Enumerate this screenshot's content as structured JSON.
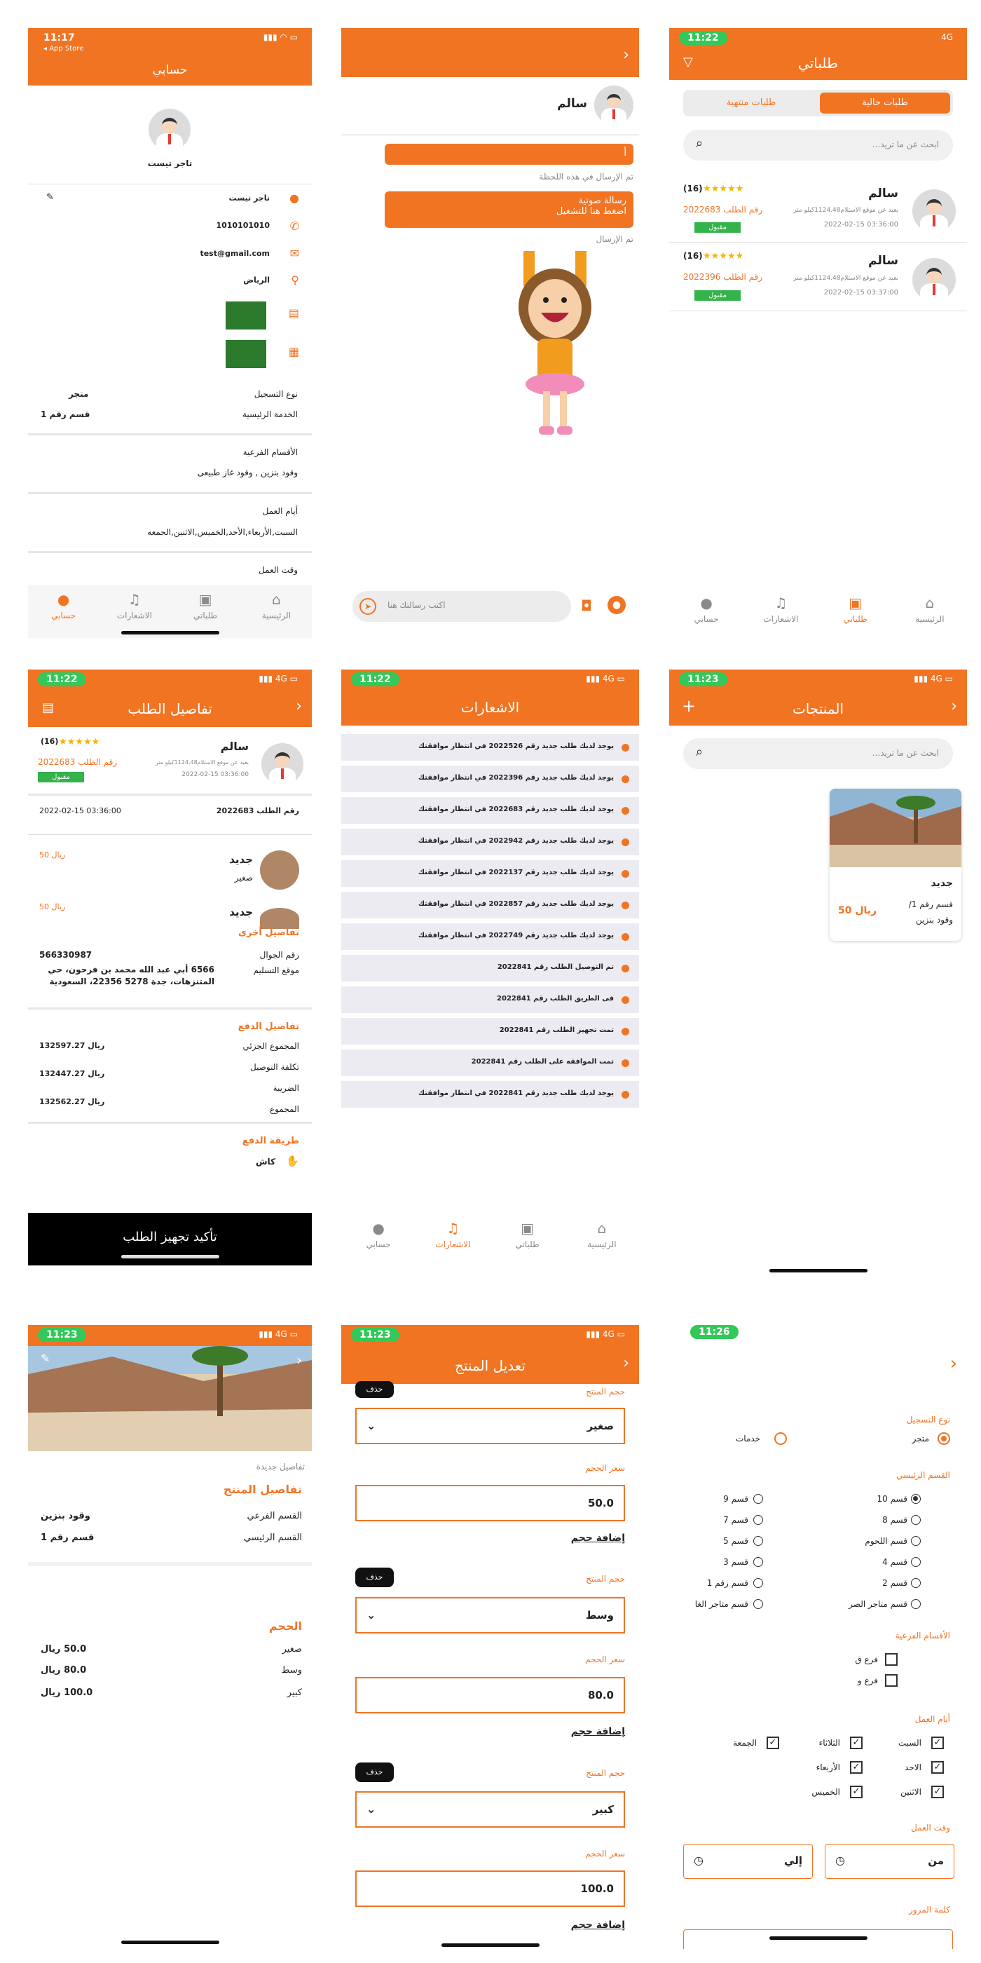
{
  "s1": {
    "time": "11:17",
    "back_store": "◂ App Store",
    "title": "حسابي",
    "name": "تاجر تيست",
    "rows": [
      {
        "icon": "person-icon",
        "value": "تاجر تيست"
      },
      {
        "icon": "phone-icon",
        "value": "1010101010"
      },
      {
        "icon": "mail-icon",
        "value": "test@gmail.com"
      },
      {
        "icon": "location-icon",
        "value": "الرياض"
      }
    ],
    "reg_type_label": "نوع التسجيل",
    "reg_type_value": "متجر",
    "main_label": "الخدمة الرئيسية",
    "main_value": "قسم رقم 1",
    "sub_label": "الأقسام الفرعية",
    "sub_value": "وقود بنزين , وقود غاز طبيعى",
    "days_label": "أيام العمل",
    "days_value": "السبت,الأربعاء,الأحد,الخميس,الاثنين,الجمعه",
    "time_label": "وقت العمل"
  },
  "nav": {
    "home": "الرئيسية",
    "orders": "طلباتي",
    "notifs": "الاشعارات",
    "account": "حسابي"
  },
  "s2": {
    "name": "سالم",
    "msg1": "أ",
    "msg1_status": "تم الإرسال في هذه اللحظة",
    "msg2_line1": "رسالة صوتية",
    "msg2_line2": "اضغط هنا للتشغيل",
    "msg2_status": "تم الإرسال",
    "input_placeholder": "اكتب رسالتك هنا"
  },
  "s3": {
    "time": "11:22",
    "sig": "4G",
    "title": "طلباتي",
    "tab_current": "طلبات حالية",
    "tab_done": "طلبات منتهية",
    "search_placeholder": "ابحث عن ما تريد...",
    "orders": [
      {
        "name": "سالم",
        "count": "(16)",
        "loc": "بعيد عن موقع الاستلام1124.48كيلو متر",
        "order": "رقم الطلب 2022683",
        "date": "2022-02-15 03:36:00",
        "status": "مقبول"
      },
      {
        "name": "سالم",
        "count": "(16)",
        "loc": "بعيد عن موقع الاستلام1124.48كيلو متر",
        "order": "رقم الطلب 2022396",
        "date": "2022-02-15 03:37:00",
        "status": "مقبول"
      }
    ]
  },
  "s4": {
    "time": "11:22",
    "title": "تفاصيل الطلب",
    "name": "سالم",
    "count": "(16)",
    "order": "رقم الطلب 2022683",
    "loc": "بعيد عن موقع الاستلام1124.48كيلو متر",
    "date": "2022-02-15 03:36:00",
    "status": "مقبول",
    "order_no": "رقم الطلب 2022683",
    "date2": "2022-02-15 03:36:00",
    "items": [
      {
        "name": "جديد",
        "size": "صغير",
        "price": "50 ريال"
      },
      {
        "name": "جديد",
        "size": "",
        "price": "50 ريال"
      }
    ],
    "other_title": "تفاصيل أخرى",
    "phone_label": "رقم الجوال",
    "phone": "566330987",
    "addr_label": "موقع التسليم",
    "addr": "6566 أبي عبد الله محمد بن فرحون، حي المتنزهات، جدة 5278 22356، السعودية",
    "pay_title": "تفاصيل الدفع",
    "subtotal_label": "المجموع الجزئي",
    "subtotal": "132597.27 ريال",
    "delivery_label": "تكلفة التوصيل",
    "delivery": "132447.27 ريال",
    "tax_label": "الضريبة",
    "total_label": "المجموع",
    "total": "132562.27 ريال",
    "method_title": "طريقة الدفع",
    "method": "كاش",
    "confirm": "تأكيد تجهيز الطلب"
  },
  "s5": {
    "time": "11:22",
    "title": "الاشعارات",
    "items": [
      "يوجد لديك طلب جديد رقم 2022526 في انتظار موافقتك",
      "يوجد لديك طلب جديد رقم 2022396 في انتظار موافقتك",
      "يوجد لديك طلب جديد رقم 2022683 في انتظار موافقتك",
      "يوجد لديك طلب جديد رقم 2022942 في انتظار موافقتك",
      "يوجد لديك طلب جديد رقم 2022137 في انتظار موافقتك",
      "يوجد لديك طلب جديد رقم 2022857 في انتظار موافقتك",
      "يوجد لديك طلب جديد رقم 2022749 في انتظار موافقتك",
      "تم التوصيل الطلب رقم 2022841",
      "فى الطريق الطلب رقم 2022841",
      "تمت تجهيز الطلب رقم 2022841",
      "تمت الموافقه على الطلب رقم 2022841",
      "يوجد لديك طلب جديد رقم 2022841 في انتظار موافقتك"
    ]
  },
  "s6": {
    "time": "11:23",
    "title": "المنتجات",
    "search_placeholder": "ابحث عن ما تريد...",
    "product_name": "جديد",
    "product_cat": "قسم رقم 1/",
    "product_sub": "وقود بنزين",
    "product_price": "50 ريال"
  },
  "s7": {
    "time": "11:23",
    "more": "تفاصيل جديدة",
    "title": "تفاصيل المنتج",
    "sub_label": "القسم الفرعي",
    "sub_value": "وقود بنزين",
    "main_label": "القسم الرئيسي",
    "main_value": "قسم رقم 1",
    "size_title": "الحجم",
    "sizes": [
      {
        "name": "صغير",
        "price": "50.0 ريال"
      },
      {
        "name": "وسط",
        "price": "80.0 ريال"
      },
      {
        "name": "كبير",
        "price": "100.0 ريال"
      }
    ]
  },
  "s8": {
    "time": "11:23",
    "title": "تعديل المنتج",
    "size_label": "حجم المنتج",
    "price_label": "سعر الحجم",
    "delete": "حذف",
    "add": "إضافة حجم",
    "sizes": [
      {
        "name": "صغير",
        "price": "50.0"
      },
      {
        "name": "وسط",
        "price": "80.0"
      },
      {
        "name": "كبير",
        "price": "100.0"
      }
    ]
  },
  "s9": {
    "time": "11:26",
    "reg_title": "نوع التسجيل",
    "store": "متجر",
    "services": "خدمات",
    "main_title": "القسم الرئيسي",
    "cats": [
      [
        "قسم 10",
        "قسم 9"
      ],
      [
        "قسم 8",
        "قسم 7"
      ],
      [
        "قسم اللحوم",
        "قسم 5"
      ],
      [
        "قسم 4",
        "قسم 3"
      ],
      [
        "قسم 2",
        "قسم رقم 1"
      ],
      [
        "قسم متاجر الصر",
        "قسم متاجر الغا"
      ]
    ],
    "sub_title": "الأقسام الفرعية",
    "subs": [
      "فرع ق",
      "فرع و"
    ],
    "days_title": "أيام العمل",
    "days": [
      [
        "السبت",
        "الثلاثاء",
        "الجمعة"
      ],
      [
        "الاحد",
        "الأربعاء",
        ""
      ],
      [
        "الاثنين",
        "الخميس",
        ""
      ]
    ],
    "time_title": "وقت العمل",
    "from": "من",
    "to": "إلي",
    "pass_title": "كلمة المرور"
  }
}
